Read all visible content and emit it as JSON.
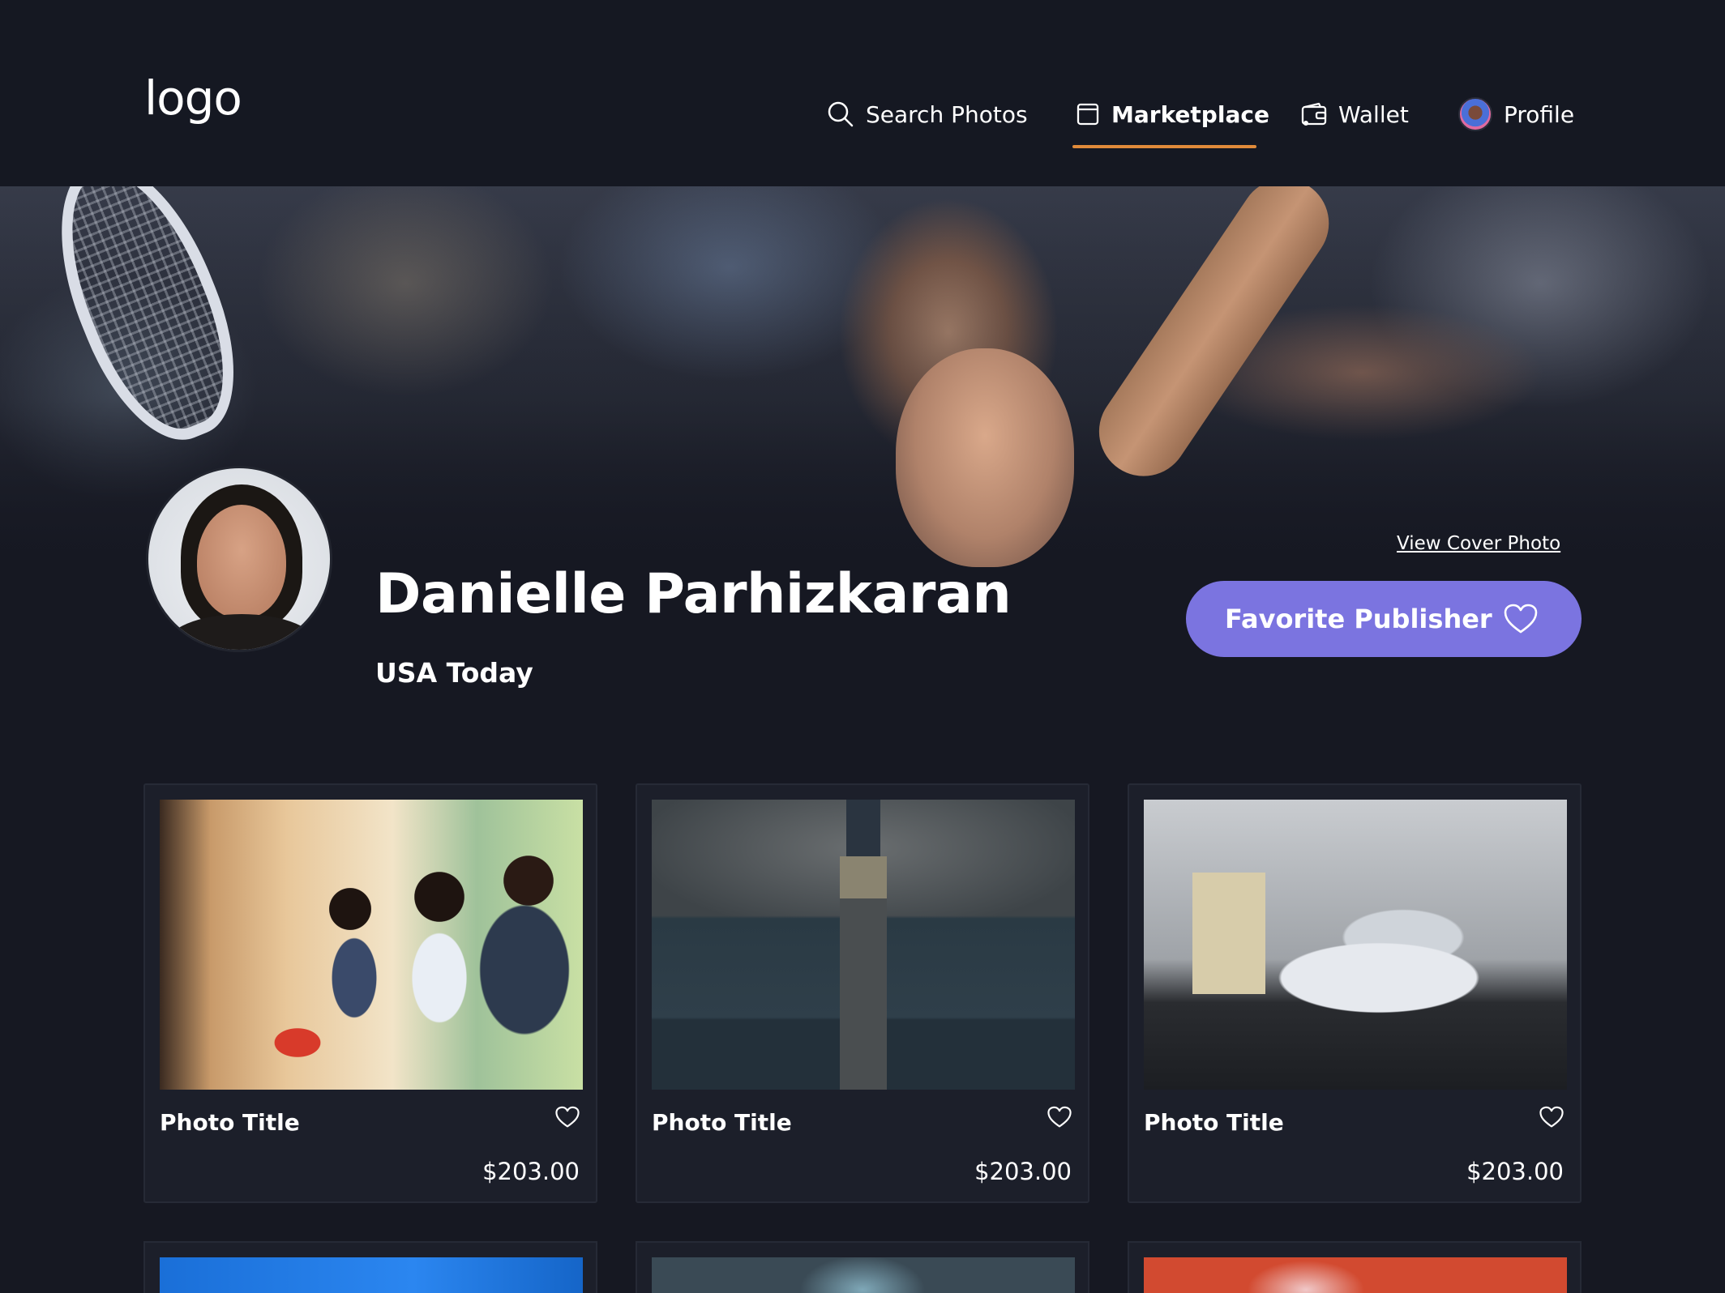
{
  "header": {
    "logo": "logo",
    "nav": [
      {
        "label": "Search Photos",
        "icon": "search-icon",
        "active": false
      },
      {
        "label": "Marketplace",
        "icon": "marketplace-icon",
        "active": true
      },
      {
        "label": "Wallet",
        "icon": "wallet-icon",
        "active": false
      },
      {
        "label": "Profile",
        "icon": "avatar",
        "active": false
      }
    ],
    "active_indicator_color": "#e08a3a"
  },
  "cover": {
    "view_cover_label": "View Cover Photo"
  },
  "publisher": {
    "name": "Danielle Parhizkaran",
    "organization": "USA Today",
    "favorite_button_label": "Favorite Publisher",
    "accent_color": "#7b74e0"
  },
  "photos": [
    {
      "title": "Photo Title",
      "price": "$203.00"
    },
    {
      "title": "Photo Title",
      "price": "$203.00"
    },
    {
      "title": "Photo Title",
      "price": "$203.00"
    }
  ],
  "colors": {
    "background": "#161822",
    "card": "#1c1f2a"
  }
}
